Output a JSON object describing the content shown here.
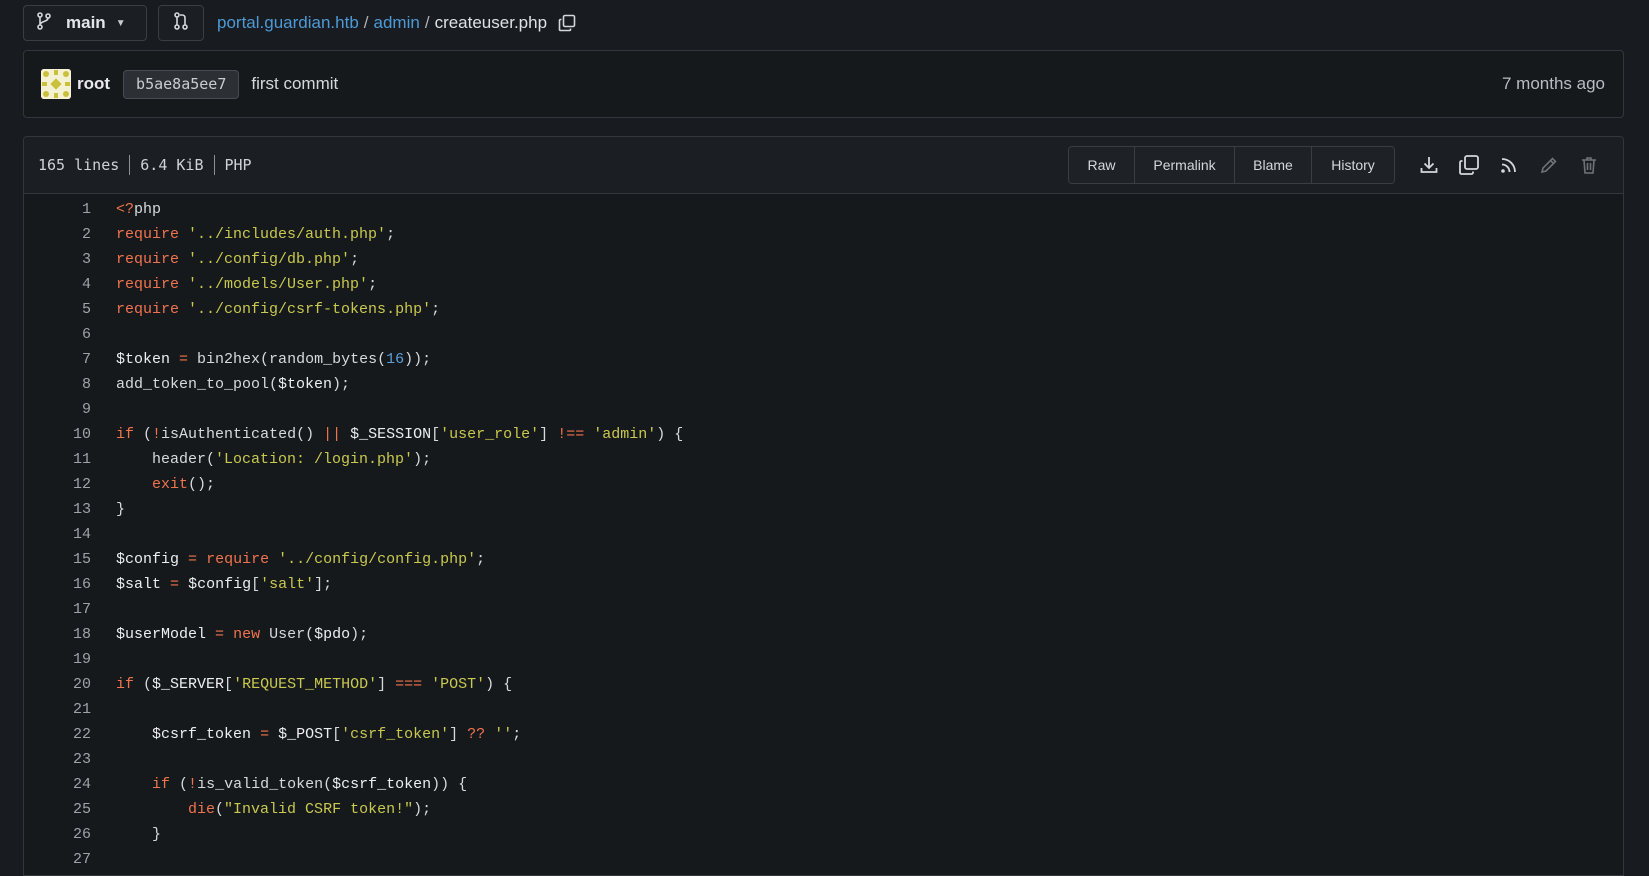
{
  "topbar": {
    "branch": "main",
    "breadcrumb": {
      "repo": "portal.guardian.htb",
      "sep1": "/",
      "dir": "admin",
      "sep2": "/",
      "file": "createuser.php"
    }
  },
  "commit": {
    "author": "root",
    "sha": "b5ae8a5ee7",
    "message": "first commit",
    "time": "7 months ago"
  },
  "file": {
    "lines": "165 lines",
    "size": "6.4 KiB",
    "lang": "PHP",
    "buttons": {
      "raw": "Raw",
      "permalink": "Permalink",
      "blame": "Blame",
      "history": "History"
    },
    "icons": [
      "download-icon",
      "copy-icon",
      "rss-icon",
      "edit-icon",
      "delete-icon"
    ]
  },
  "colors": {
    "keyword": "#f0734e",
    "string": "#c9c84f",
    "number": "#5aa0da",
    "link": "#4e9ad6"
  },
  "code": [
    [
      [
        "k",
        "<?"
      ],
      [
        "t",
        "php"
      ]
    ],
    [
      [
        "k",
        "require"
      ],
      [
        "t",
        " "
      ],
      [
        "s",
        "'../includes/auth.php'"
      ],
      [
        "t",
        ";"
      ]
    ],
    [
      [
        "k",
        "require"
      ],
      [
        "t",
        " "
      ],
      [
        "s",
        "'../config/db.php'"
      ],
      [
        "t",
        ";"
      ]
    ],
    [
      [
        "k",
        "require"
      ],
      [
        "t",
        " "
      ],
      [
        "s",
        "'../models/User.php'"
      ],
      [
        "t",
        ";"
      ]
    ],
    [
      [
        "k",
        "require"
      ],
      [
        "t",
        " "
      ],
      [
        "s",
        "'../config/csrf-tokens.php'"
      ],
      [
        "t",
        ";"
      ]
    ],
    [],
    [
      [
        "v",
        "$token"
      ],
      [
        "t",
        " "
      ],
      [
        "k",
        "="
      ],
      [
        "t",
        " bin2hex(random_bytes("
      ],
      [
        "n",
        "16"
      ],
      [
        "t",
        "));"
      ]
    ],
    [
      [
        "t",
        "add_token_to_pool("
      ],
      [
        "v",
        "$token"
      ],
      [
        "t",
        ");"
      ]
    ],
    [],
    [
      [
        "k",
        "if"
      ],
      [
        "t",
        " ("
      ],
      [
        "k",
        "!"
      ],
      [
        "t",
        "isAuthenticated() "
      ],
      [
        "k",
        "||"
      ],
      [
        "t",
        " "
      ],
      [
        "v",
        "$_SESSION"
      ],
      [
        "t",
        "["
      ],
      [
        "s",
        "'user_role'"
      ],
      [
        "t",
        "] "
      ],
      [
        "k",
        "!=="
      ],
      [
        "t",
        " "
      ],
      [
        "s",
        "'admin'"
      ],
      [
        "t",
        ") {"
      ]
    ],
    [
      [
        "t",
        "    header("
      ],
      [
        "s",
        "'Location: /login.php'"
      ],
      [
        "t",
        ");"
      ]
    ],
    [
      [
        "t",
        "    "
      ],
      [
        "k",
        "exit"
      ],
      [
        "t",
        "();"
      ]
    ],
    [
      [
        "t",
        "}"
      ]
    ],
    [],
    [
      [
        "v",
        "$config"
      ],
      [
        "t",
        " "
      ],
      [
        "k",
        "="
      ],
      [
        "t",
        " "
      ],
      [
        "k",
        "require"
      ],
      [
        "t",
        " "
      ],
      [
        "s",
        "'../config/config.php'"
      ],
      [
        "t",
        ";"
      ]
    ],
    [
      [
        "v",
        "$salt"
      ],
      [
        "t",
        " "
      ],
      [
        "k",
        "="
      ],
      [
        "t",
        " "
      ],
      [
        "v",
        "$config"
      ],
      [
        "t",
        "["
      ],
      [
        "s",
        "'salt'"
      ],
      [
        "t",
        "];"
      ]
    ],
    [],
    [
      [
        "v",
        "$userModel"
      ],
      [
        "t",
        " "
      ],
      [
        "k",
        "="
      ],
      [
        "t",
        " "
      ],
      [
        "k",
        "new"
      ],
      [
        "t",
        " User("
      ],
      [
        "v",
        "$pdo"
      ],
      [
        "t",
        ");"
      ]
    ],
    [],
    [
      [
        "k",
        "if"
      ],
      [
        "t",
        " ("
      ],
      [
        "v",
        "$_SERVER"
      ],
      [
        "t",
        "["
      ],
      [
        "s",
        "'REQUEST_METHOD'"
      ],
      [
        "t",
        "] "
      ],
      [
        "k",
        "==="
      ],
      [
        "t",
        " "
      ],
      [
        "s",
        "'POST'"
      ],
      [
        "t",
        ") {"
      ]
    ],
    [],
    [
      [
        "t",
        "    "
      ],
      [
        "v",
        "$csrf_token"
      ],
      [
        "t",
        " "
      ],
      [
        "k",
        "="
      ],
      [
        "t",
        " "
      ],
      [
        "v",
        "$_POST"
      ],
      [
        "t",
        "["
      ],
      [
        "s",
        "'csrf_token'"
      ],
      [
        "t",
        "] "
      ],
      [
        "k",
        "??"
      ],
      [
        "t",
        " "
      ],
      [
        "s",
        "''"
      ],
      [
        "t",
        ";"
      ]
    ],
    [],
    [
      [
        "t",
        "    "
      ],
      [
        "k",
        "if"
      ],
      [
        "t",
        " ("
      ],
      [
        "k",
        "!"
      ],
      [
        "t",
        "is_valid_token("
      ],
      [
        "v",
        "$csrf_token"
      ],
      [
        "t",
        ")) {"
      ]
    ],
    [
      [
        "t",
        "        "
      ],
      [
        "k",
        "die"
      ],
      [
        "t",
        "("
      ],
      [
        "s",
        "\"Invalid CSRF token!\""
      ],
      [
        "t",
        ");"
      ]
    ],
    [
      [
        "t",
        "    }"
      ]
    ],
    []
  ]
}
